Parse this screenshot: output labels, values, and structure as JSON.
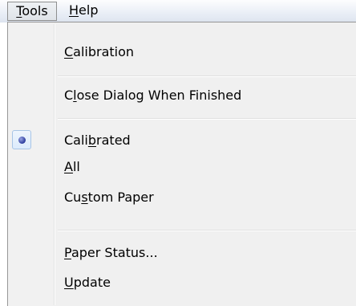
{
  "menubar": {
    "tools": {
      "prefix": "",
      "accel": "T",
      "rest": "ools"
    },
    "help": {
      "prefix": "",
      "accel": "H",
      "rest": "elp"
    }
  },
  "menu": {
    "calibration": {
      "prefix": "",
      "accel": "C",
      "rest": "alibration"
    },
    "close_dialog": {
      "prefix": "C",
      "accel": "l",
      "rest": "ose Dialog When Finished"
    },
    "calibrated": {
      "prefix": "Cali",
      "accel": "b",
      "rest": "rated",
      "checked": true
    },
    "all": {
      "prefix": "",
      "accel": "A",
      "rest": "ll"
    },
    "custom_paper": {
      "prefix": "Cu",
      "accel": "s",
      "rest": "tom Paper"
    },
    "paper_status": {
      "prefix": "",
      "accel": "P",
      "rest": "aper Status..."
    },
    "update": {
      "prefix": "",
      "accel": "U",
      "rest": "pdate"
    }
  },
  "icons": {
    "radio_indicator": "radio-bullet-icon"
  },
  "colors": {
    "menu_background": "#f0f0f0",
    "menubar_gradient_top": "#fdfdfe",
    "menubar_gradient_bottom": "#dde4ef",
    "radio_highlight_border": "#a8c5e6",
    "radio_dot": "#2a3a9c"
  }
}
